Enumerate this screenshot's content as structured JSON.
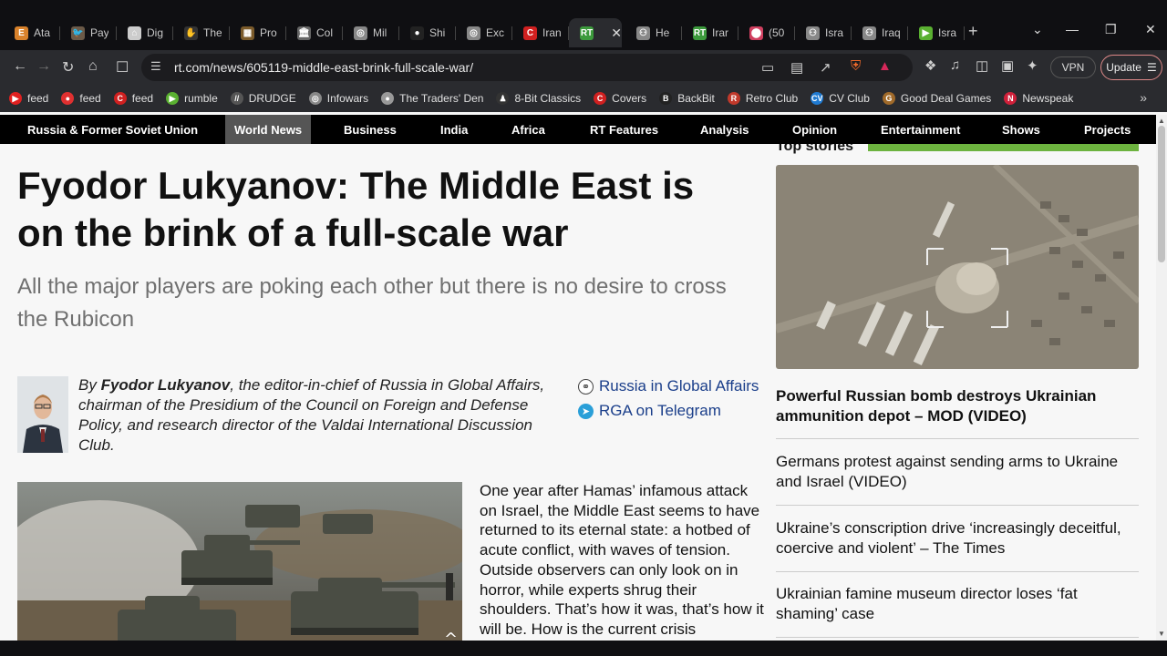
{
  "tabs": [
    {
      "label": "Ata",
      "icon": "e-icon",
      "color": "#d9822b",
      "glyph": "E"
    },
    {
      "label": "Pay",
      "icon": "bird-icon",
      "color": "#6b5a48",
      "glyph": "🐦"
    },
    {
      "label": "Dig",
      "icon": "house-icon",
      "color": "#cccccc",
      "glyph": "⌂"
    },
    {
      "label": "The",
      "icon": "hand-icon",
      "color": "#333333",
      "glyph": "✋"
    },
    {
      "label": "Pro",
      "icon": "painting-icon",
      "color": "#7a5a2a",
      "glyph": "▦"
    },
    {
      "label": "Col",
      "icon": "building-icon",
      "color": "#666666",
      "glyph": "🏛"
    },
    {
      "label": "Mil",
      "icon": "globe-icon",
      "color": "#888888",
      "glyph": "◎"
    },
    {
      "label": "Shi",
      "icon": "dot-icon",
      "color": "#222222",
      "glyph": "●"
    },
    {
      "label": "Exc",
      "icon": "globe-icon",
      "color": "#888888",
      "glyph": "◎"
    },
    {
      "label": "Iran",
      "icon": "red-c-icon",
      "color": "#d02020",
      "glyph": "C"
    },
    {
      "label": "",
      "icon": "rt-icon",
      "color": "#3c9a3c",
      "glyph": "RT",
      "active": true
    },
    {
      "label": "He",
      "icon": "person-icon",
      "color": "#888888",
      "glyph": "⚇"
    },
    {
      "label": "Irar",
      "icon": "rt-icon",
      "color": "#3c9a3c",
      "glyph": "RT"
    },
    {
      "label": "(50",
      "icon": "dots-icon",
      "color": "#d04060",
      "glyph": "⬤"
    },
    {
      "label": "Isra",
      "icon": "person-icon",
      "color": "#888888",
      "glyph": "⚇"
    },
    {
      "label": "Iraq",
      "icon": "person-icon",
      "color": "#888888",
      "glyph": "⚇"
    },
    {
      "label": "Isra",
      "icon": "rumble-icon",
      "color": "#5ab031",
      "glyph": "▶"
    }
  ],
  "active_tab_close": "✕",
  "new_tab": "+",
  "window_controls": [
    "⌄",
    "—",
    "❐",
    "✕"
  ],
  "address": {
    "url": "rt.com/news/605119-middle-east-brink-full-scale-war/",
    "vpn": "VPN",
    "update": "Update"
  },
  "bookmarks": [
    {
      "label": "feed",
      "icon": "youtube-icon",
      "color": "#e02020",
      "glyph": "▶"
    },
    {
      "label": "feed",
      "icon": "reddit-icon",
      "color": "#e03030",
      "glyph": "●"
    },
    {
      "label": "feed",
      "icon": "red-c-icon",
      "color": "#d02020",
      "glyph": "C"
    },
    {
      "label": "rumble",
      "icon": "rumble-icon",
      "color": "#5ab031",
      "glyph": "▶"
    },
    {
      "label": "DRUDGE",
      "icon": "slash-icon",
      "color": "#555555",
      "glyph": "//"
    },
    {
      "label": "Infowars",
      "icon": "globe-icon",
      "color": "#888888",
      "glyph": "◎"
    },
    {
      "label": "The Traders' Den",
      "icon": "circle-icon",
      "color": "#999999",
      "glyph": "●"
    },
    {
      "label": "8-Bit Classics",
      "icon": "character-icon",
      "color": "#333333",
      "glyph": "♟"
    },
    {
      "label": "Covers",
      "icon": "red-c-icon",
      "color": "#d02020",
      "glyph": "C"
    },
    {
      "label": "BackBit",
      "icon": "bb-icon",
      "color": "#222222",
      "glyph": "B"
    },
    {
      "label": "Retro Club",
      "icon": "shield-icon",
      "color": "#c0392b",
      "glyph": "R"
    },
    {
      "label": "CV Club",
      "icon": "cv-icon",
      "color": "#1f7ad1",
      "glyph": "CV"
    },
    {
      "label": "Good Deal Games",
      "icon": "gdg-icon",
      "color": "#a06a2a",
      "glyph": "G"
    },
    {
      "label": "Newspeak",
      "icon": "n-icon",
      "color": "#d0203a",
      "glyph": "N"
    }
  ],
  "bookmarks_more": "»",
  "sitenav": [
    "Russia & Former Soviet Union",
    "World News",
    "Business",
    "India",
    "Africa",
    "RT Features",
    "Analysis",
    "Opinion",
    "Entertainment",
    "Shows",
    "Projects"
  ],
  "article": {
    "title": "Fyodor Lukyanov: The Middle East is on the brink of a full-scale war",
    "subtitle": "All the major players are poking each other but there is no desire to cross the Rubicon",
    "byline_prefix": "By ",
    "author": "Fyodor Lukyanov",
    "byline_rest": ", the editor-in-chief of Russia in Global Affairs, chairman of the Presidium of the Council on Foreign and Defense Policy, and research director of the Valdai International Discussion Club.",
    "links": [
      {
        "label": "Russia in Global Affairs",
        "icon": "globe-icon"
      },
      {
        "label": "RGA on Telegram",
        "icon": "telegram-icon"
      }
    ],
    "body": "One year after Hamas’ infamous attack on Israel, the Middle East seems to have returned to its eternal state: a hotbed of acute conflict, with waves of tension. Outside observers can only look on in horror, while experts shrug their shoulders. That’s how it was, that’s how it will be. How is the current crisis"
  },
  "sidebar": {
    "heading": "Top stories",
    "stories": [
      "Powerful Russian bomb destroys Ukrainian ammunition depot – MOD (VIDEO)",
      "Germans protest against sending arms to Ukraine and Israel (VIDEO)",
      "Ukraine’s conscription drive ‘increasingly deceitful, coercive and violent’ – The Times",
      "Ukrainian famine museum director loses ‘fat shaming’ case"
    ]
  }
}
